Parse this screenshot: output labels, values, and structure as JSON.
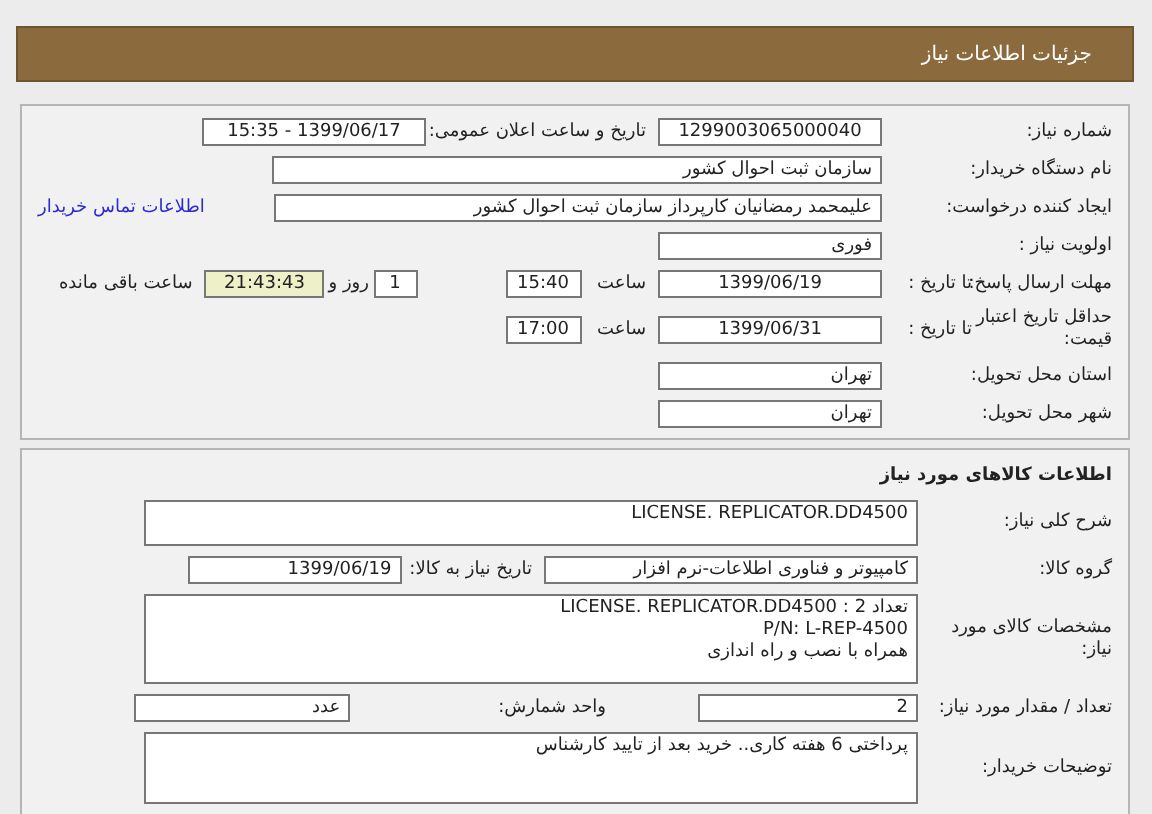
{
  "header": {
    "title": "جزئیات اطلاعات نیاز"
  },
  "need": {
    "number_label": "شماره نیاز:",
    "number": "1299003065000040",
    "announce_label": "تاریخ و ساعت اعلان عمومی:",
    "announce": "1399/06/17 - 15:35",
    "buyer_label": "نام دستگاه خریدار:",
    "buyer": "سازمان ثبت احوال کشور",
    "creator_label": "ایجاد کننده درخواست:",
    "creator": "علیمحمد رمضانیان کارپرداز سازمان ثبت احوال کشور",
    "contact_link": "اطلاعات تماس خریدار",
    "priority_label": "اولویت نیاز :",
    "priority": "فوری",
    "deadline": {
      "label": "مهلت ارسال پاسخ:",
      "to_date_label": "تا تاریخ :",
      "date": "1399/06/19",
      "time_label": "ساعت",
      "time": "15:40",
      "days": "1",
      "days_suffix": "روز و",
      "remaining": "21:43:43",
      "remaining_label": "ساعت باقی مانده"
    },
    "validity": {
      "label": "حداقل تاریخ اعتبار قیمت:",
      "to_date_label": "تا تاریخ :",
      "date": "1399/06/31",
      "time_label": "ساعت",
      "time": "17:00"
    },
    "province_label": "استان محل تحویل:",
    "province": "تهران",
    "city_label": "شهر محل تحویل:",
    "city": "تهران"
  },
  "goods": {
    "title": "اطلاعات کالاهای مورد نیاز",
    "summary_label": "شرح کلی نیاز:",
    "summary": "LICENSE. REPLICATOR.DD4500",
    "group_label": "گروه کالا:",
    "group": "کامپیوتر و فناوری اطلاعات-نرم افزار",
    "need_date_label": "تاریخ نیاز به کالا:",
    "need_date": "1399/06/19",
    "specs_label": "مشخصات کالای مورد نیاز:",
    "specs": [
      "تعداد 2 : LICENSE. REPLICATOR.DD4500",
      "P/N: L-REP-4500",
      "همراه با نصب و راه اندازی"
    ],
    "quantity_label": "تعداد / مقدار مورد نیاز:",
    "quantity": "2",
    "unit_label": "واحد شمارش:",
    "unit": "عدد",
    "notes_label": "توضیحات خریدار:",
    "notes": "پرداختی 6 هفته کاری.. خرید بعد از تایید کارشناس"
  }
}
